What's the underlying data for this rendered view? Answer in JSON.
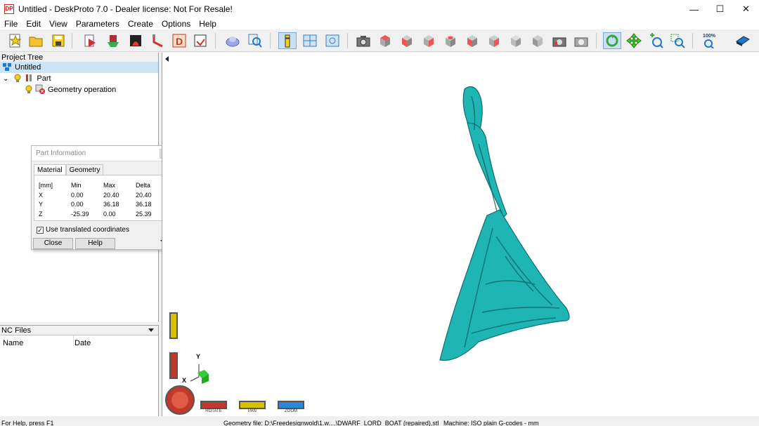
{
  "window": {
    "title": "Untitled - DeskProto 7.0 - Dealer license: Not For Resale!",
    "app_icon_text": "DP",
    "minimize": "—",
    "maximize": "☐",
    "close": "✕"
  },
  "menu": [
    "File",
    "Edit",
    "View",
    "Parameters",
    "Create",
    "Options",
    "Help"
  ],
  "toolbar": {
    "zoom_percent_label": "100%"
  },
  "project_tree": {
    "header": "Project Tree",
    "items": [
      {
        "label": "Untitled",
        "icon": "project-icon",
        "selected": true
      },
      {
        "label": "Part",
        "icon": "part-icon"
      },
      {
        "label": "Geometry operation",
        "icon": "geometry-operation-icon"
      }
    ]
  },
  "nc_files": {
    "header": "NC Files",
    "columns": [
      "Name",
      "Date"
    ]
  },
  "part_info": {
    "title": "Part Information",
    "tabs": [
      "Material",
      "Geometry"
    ],
    "active_tab": "Material",
    "headers": [
      "[mm]",
      "Min",
      "Max",
      "Delta"
    ],
    "rows": [
      [
        "X",
        "0.00",
        "20.40",
        "20.40"
      ],
      [
        "Y",
        "0.00",
        "36.18",
        "36.18"
      ],
      [
        "Z",
        "-25.39",
        "0.00",
        "25.39"
      ]
    ],
    "checkbox_label": "Use translated coordinates",
    "checkbox_checked": true,
    "close_button": "Close",
    "help_button": "Help"
  },
  "viewport_controls": {
    "rotate_label": "ROTATE",
    "pan_label": "PAN",
    "zoom_label": "ZOOM",
    "axis_y": "Y",
    "axis_x": "X"
  },
  "model": {
    "color": "#1fb5b5"
  },
  "status": {
    "help_text": "For Help, press F1",
    "geometry_file": "Geometry file: D:\\Freedesignwold\\1.w....\\DWARF_LORD_BOAT (repaired).stl",
    "machine": "Machine: ISO plain G-codes - mm"
  }
}
